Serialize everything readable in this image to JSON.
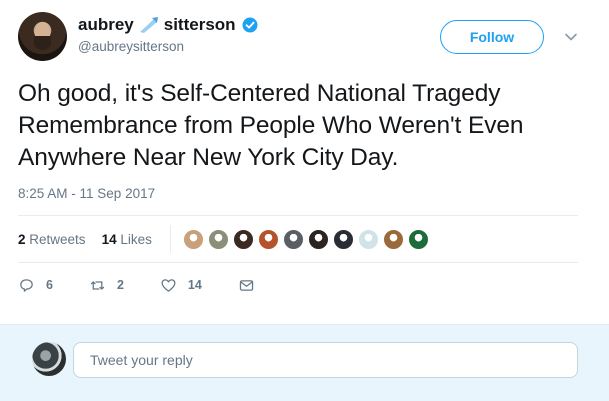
{
  "user": {
    "display_name_first": "aubrey",
    "display_name_last": "sitterson",
    "handle": "@aubreysitterson"
  },
  "follow_label": "Follow",
  "tweet": {
    "text": "Oh good, it's Self-Centered National Tragedy Remembrance from People Who Weren't Even Anywhere Near New York City Day.",
    "timestamp": "8:25 AM - 11 Sep 2017"
  },
  "stats": {
    "retweets_count": "2",
    "retweets_label": "Retweets",
    "likes_count": "14",
    "likes_label": "Likes"
  },
  "actions": {
    "reply_count": "6",
    "retweet_count": "2",
    "like_count": "14"
  },
  "reply": {
    "placeholder": "Tweet your reply"
  },
  "colors": {
    "accent": "#1da1f2",
    "secondary_text": "#657786",
    "reply_background": "#e8f5fd"
  },
  "liker_avatars": [
    "#c8a07a",
    "#8a8f7a",
    "#3a2a22",
    "#b5542a",
    "#5a5f66",
    "#2c2420",
    "#2a2d33",
    "#cfe3e8",
    "#9a6a3a",
    "#1e6b3a"
  ]
}
